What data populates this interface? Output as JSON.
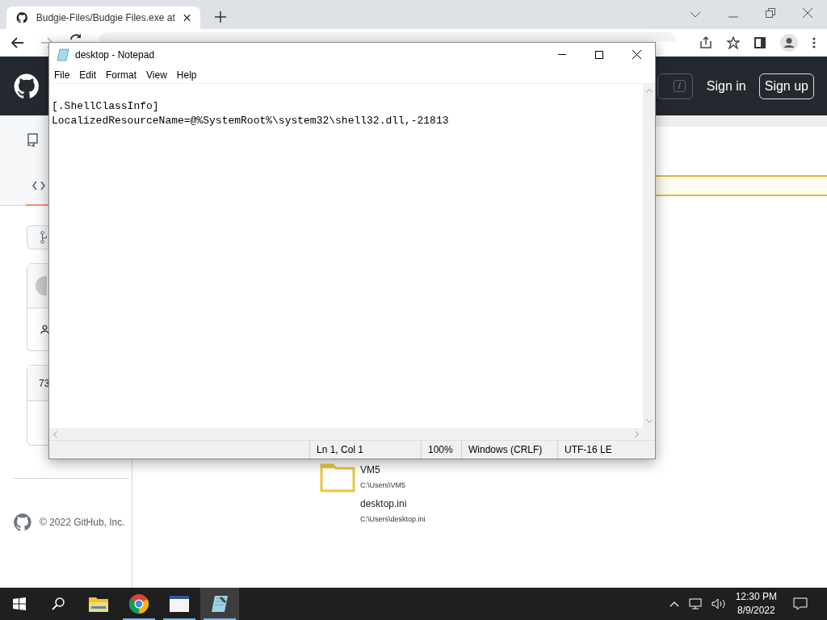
{
  "browser": {
    "tabs": [
      {
        "title": "Budgie-Files/Budgie Files.exe at",
        "selected": true
      }
    ]
  },
  "github_header": {
    "search_key": "/",
    "sign_in": "Sign in",
    "sign_up": "Sign up"
  },
  "page": {
    "card_count": "73",
    "file_list": [
      {
        "kind": "folder",
        "name": "VM5",
        "path": "C:\\Users\\VM5"
      },
      {
        "kind": "file",
        "name": "desktop.ini",
        "path": "C:\\Users\\desktop.ini"
      }
    ],
    "footer": "© 2022 GitHub, Inc."
  },
  "notepad": {
    "title": "desktop - Notepad",
    "menu": [
      "File",
      "Edit",
      "Format",
      "View",
      "Help"
    ],
    "lines": [
      "[.ShellClassInfo]",
      "LocalizedResourceName=@%SystemRoot%\\system32\\shell32.dll,-21813"
    ],
    "status": [
      "Ln 1, Col 1",
      "100%",
      "Windows (CRLF)",
      "UTF-16 LE"
    ]
  },
  "taskbar": {
    "apps": [
      {
        "kind": "explorer",
        "running": false,
        "selected": false
      },
      {
        "kind": "chrome",
        "running": true,
        "selected": false
      },
      {
        "kind": "window",
        "running": true,
        "selected": false
      },
      {
        "kind": "notepad",
        "running": true,
        "selected": true
      }
    ],
    "time": "12:30 PM",
    "date": "8/9/2022"
  }
}
